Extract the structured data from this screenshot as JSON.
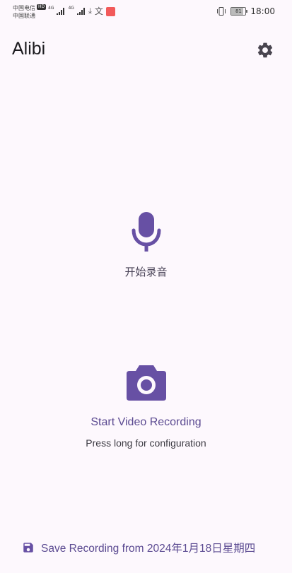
{
  "status_bar": {
    "carrier_1": "中国电信",
    "carrier_2": "中国联通",
    "hd_badge": "HD",
    "network_1": "4G",
    "network_2": "4G",
    "battery": "81",
    "battery_level_percent": 81,
    "time": "18:00"
  },
  "app_bar": {
    "title": "Alibi",
    "settings_icon": "gear-icon"
  },
  "audio": {
    "label": "开始录音",
    "icon": "microphone-icon"
  },
  "video": {
    "label": "Start Video Recording",
    "hint": "Press long for configuration",
    "icon": "camera-icon"
  },
  "save": {
    "label": "Save Recording from 2024年1月18日星期四",
    "icon": "floppy-disk-icon"
  },
  "colors": {
    "background": "#fdf8fd",
    "accent": "#6750a4",
    "accent_text": "#5b4a91",
    "title_text": "#1c1b1f"
  }
}
